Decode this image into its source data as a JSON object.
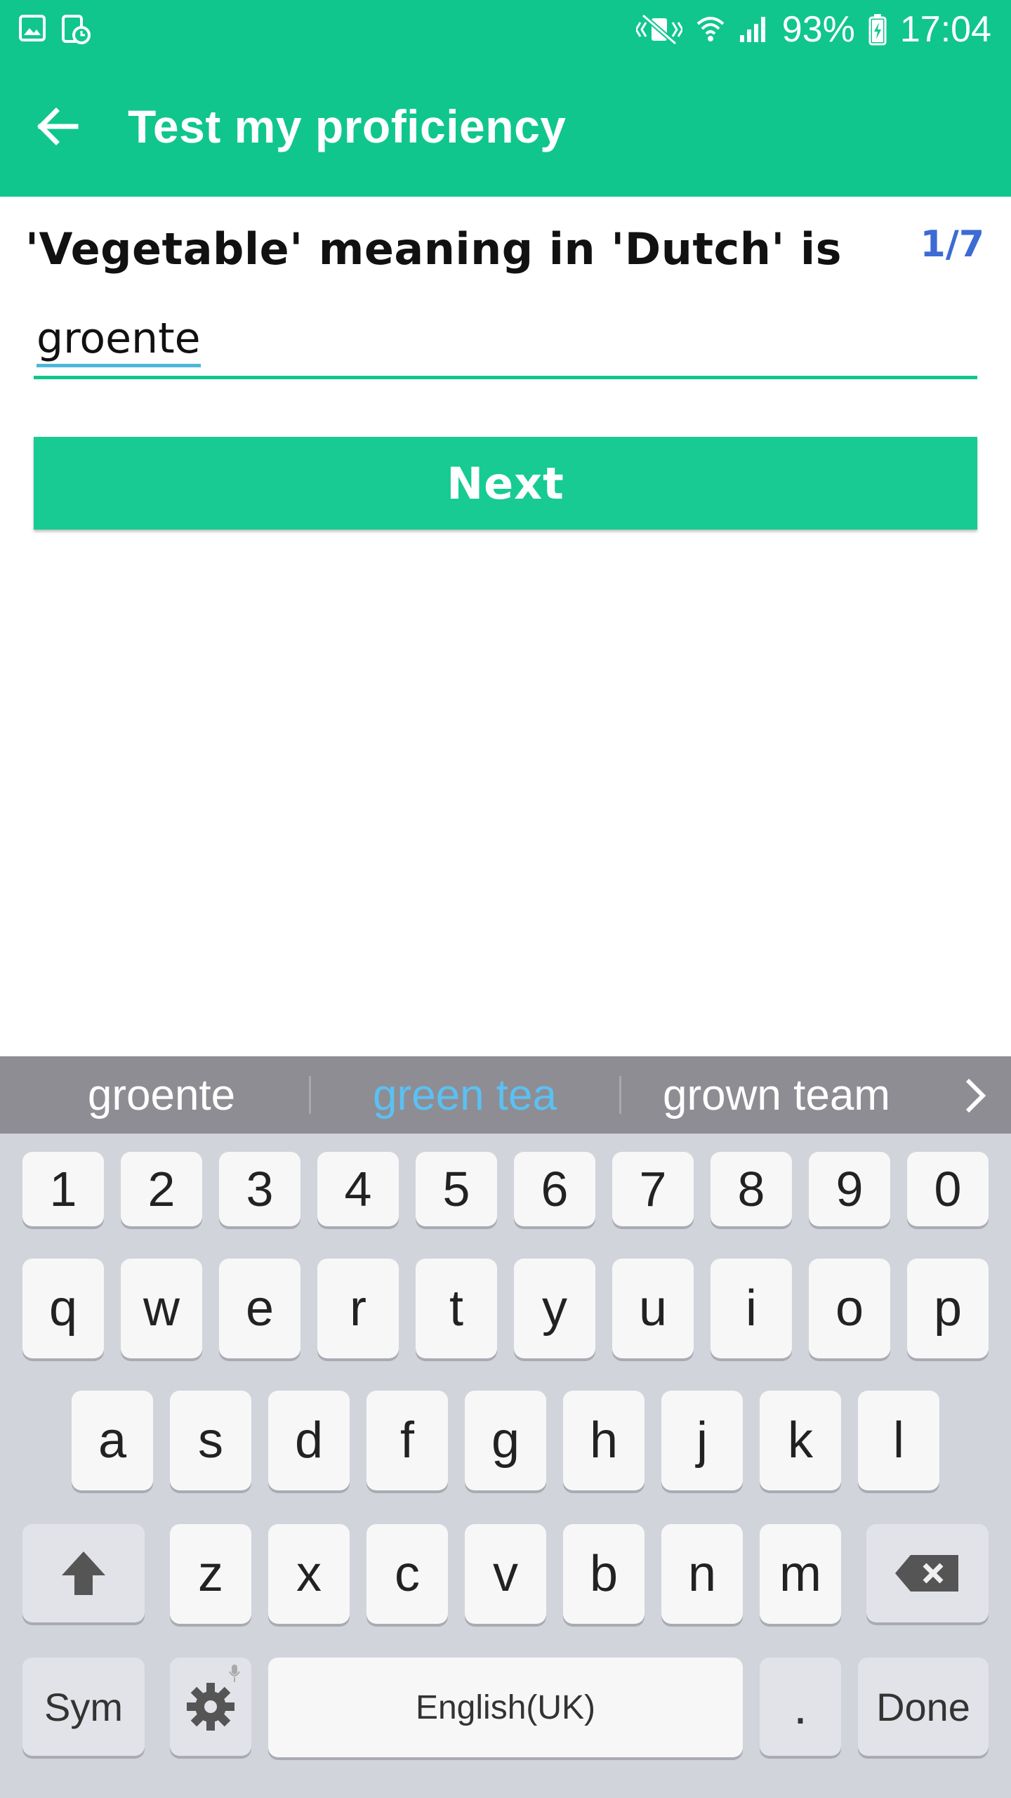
{
  "status_bar": {
    "battery": "93%",
    "time": "17:04",
    "icons": [
      "gallery-icon",
      "screenshot-clock-icon",
      "vibrate-mute-icon",
      "wifi-icon",
      "signal-icon",
      "battery-charging-icon"
    ]
  },
  "app_bar": {
    "title": "Test my proficiency",
    "back_icon": "arrow-left-icon"
  },
  "quiz": {
    "question": "'Vegetable' meaning in 'Dutch' is",
    "progress": "1/7",
    "answer_value": "groente",
    "next_label": "Next"
  },
  "keyboard": {
    "suggestions": [
      "groente",
      "green tea",
      "grown team"
    ],
    "row_numbers": [
      "1",
      "2",
      "3",
      "4",
      "5",
      "6",
      "7",
      "8",
      "9",
      "0"
    ],
    "row1": [
      "q",
      "w",
      "e",
      "r",
      "t",
      "y",
      "u",
      "i",
      "o",
      "p"
    ],
    "row2": [
      "a",
      "s",
      "d",
      "f",
      "g",
      "h",
      "j",
      "k",
      "l"
    ],
    "row3": [
      "z",
      "x",
      "c",
      "v",
      "b",
      "n",
      "m"
    ],
    "sym_label": "Sym",
    "space_label": "English(UK)",
    "period_label": ".",
    "done_label": "Done"
  },
  "colors": {
    "primary": "#10c68d",
    "button": "#17cb92",
    "counter": "#3d6bd4",
    "suggestion_highlight": "#5bc0f2"
  }
}
